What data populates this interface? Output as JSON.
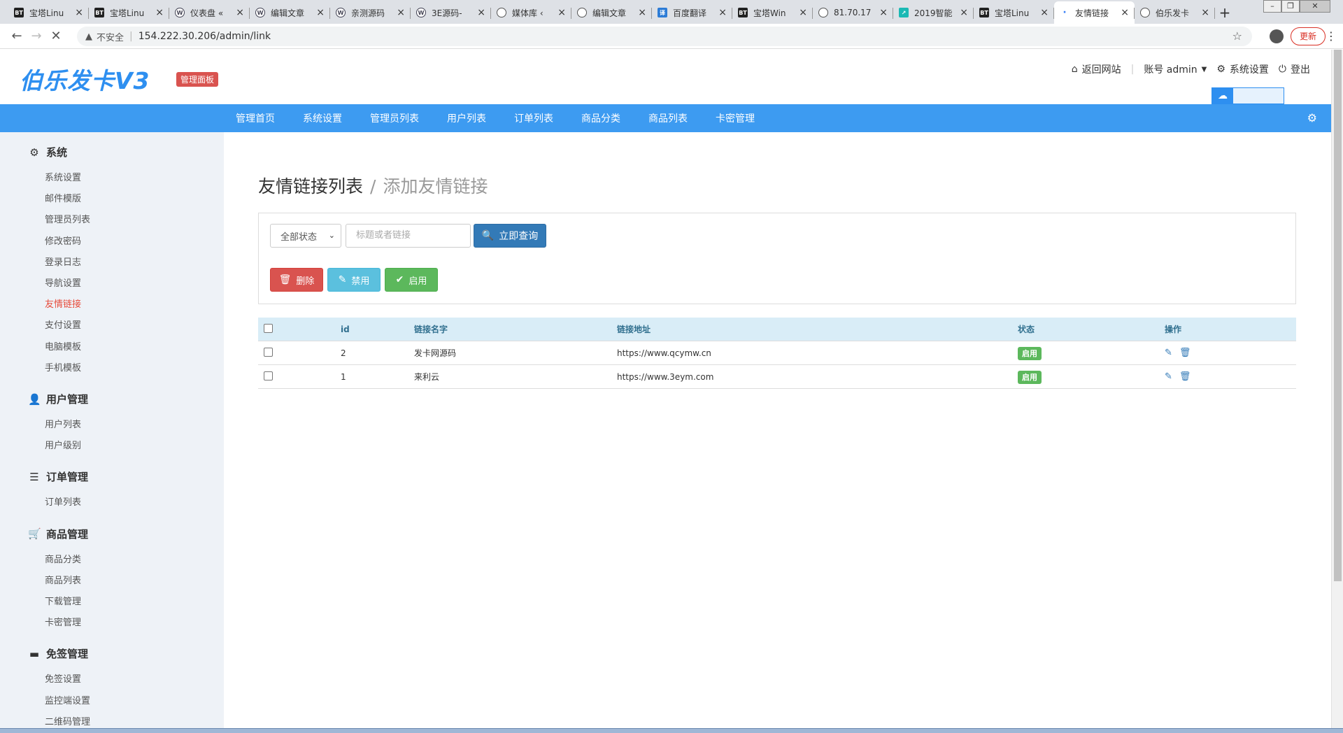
{
  "browser": {
    "tabs": [
      {
        "favicon": "BT",
        "kind": "bt",
        "title": "宝塔Linu"
      },
      {
        "favicon": "BT",
        "kind": "bt",
        "title": "宝塔Linu"
      },
      {
        "favicon": "W",
        "kind": "wp",
        "title": "仪表盘 «"
      },
      {
        "favicon": "W",
        "kind": "wp",
        "title": "编辑文章"
      },
      {
        "favicon": "W",
        "kind": "wp",
        "title": "亲测源码"
      },
      {
        "favicon": "W",
        "kind": "wp",
        "title": "3E源码-"
      },
      {
        "favicon": "",
        "kind": "globe",
        "title": "媒体库 ‹"
      },
      {
        "favicon": "",
        "kind": "globe",
        "title": "编辑文章"
      },
      {
        "favicon": "译",
        "kind": "fy",
        "title": "百度翻译"
      },
      {
        "favicon": "BT",
        "kind": "bt",
        "title": "宝塔Win"
      },
      {
        "favicon": "",
        "kind": "globe",
        "title": "81.70.17"
      },
      {
        "favicon": "↗",
        "kind": "cy",
        "title": "2019智能"
      },
      {
        "favicon": "BT",
        "kind": "bt",
        "title": "宝塔Linu"
      },
      {
        "favicon": "·",
        "kind": "dot",
        "title": "友情链接",
        "active": true
      },
      {
        "favicon": "",
        "kind": "globe",
        "title": "伯乐发卡"
      }
    ],
    "close_glyph": "×",
    "new_tab_glyph": "+",
    "security_label": "不安全",
    "url": "154.222.30.206/admin/link",
    "update_label": "更新"
  },
  "header": {
    "logo": "伯乐发卡V3",
    "admin_badge": "管理面板",
    "back_site": "返回网站",
    "account": "账号 admin",
    "settings": "系统设置",
    "logout": "登出"
  },
  "topnav": [
    "管理首页",
    "系统设置",
    "管理员列表",
    "用户列表",
    "订单列表",
    "商品分类",
    "商品列表",
    "卡密管理"
  ],
  "sidebar": {
    "groups": [
      {
        "icon": "gear-icon",
        "glyph": "⚙",
        "label": "系统",
        "items": [
          "系统设置",
          "邮件模版",
          "管理员列表",
          "修改密码",
          "登录日志",
          "导航设置",
          "友情链接",
          "支付设置",
          "电脑模板",
          "手机模板"
        ]
      },
      {
        "icon": "user-icon",
        "glyph": "👤",
        "label": "用户管理",
        "items": [
          "用户列表",
          "用户级别"
        ]
      },
      {
        "icon": "list-icon",
        "glyph": "☰",
        "label": "订单管理",
        "items": [
          "订单列表"
        ]
      },
      {
        "icon": "cart-icon",
        "glyph": "🛒",
        "label": "商品管理",
        "items": [
          "商品分类",
          "商品列表",
          "下载管理",
          "卡密管理"
        ]
      },
      {
        "icon": "card-icon",
        "glyph": "▬",
        "label": "免签管理",
        "items": [
          "免签设置",
          "监控端设置",
          "二维码管理"
        ]
      }
    ],
    "active_item": "友情链接"
  },
  "main": {
    "title": "友情链接列表",
    "separator": "/",
    "subtitle": "添加友情链接",
    "filter": {
      "status_select": "全部状态",
      "keyword_placeholder": "标题或者链接",
      "search_button": "立即查询"
    },
    "actions": {
      "delete": "删除",
      "disable": "禁用",
      "enable": "启用"
    },
    "table": {
      "columns": [
        "id",
        "链接名字",
        "链接地址",
        "状态",
        "操作"
      ],
      "rows": [
        {
          "id": "2",
          "name": "发卡网源码",
          "url": "https://www.qcymw.cn",
          "status": "启用"
        },
        {
          "id": "1",
          "name": "来利云",
          "url": "https://www.3eym.com",
          "status": "启用"
        }
      ]
    }
  },
  "colors": {
    "accent": "#3d9bf1",
    "danger": "#d9534f",
    "info": "#5bc0de",
    "success": "#5cb85c",
    "primary": "#337ab7",
    "sidebar_active": "#e74c3c"
  }
}
